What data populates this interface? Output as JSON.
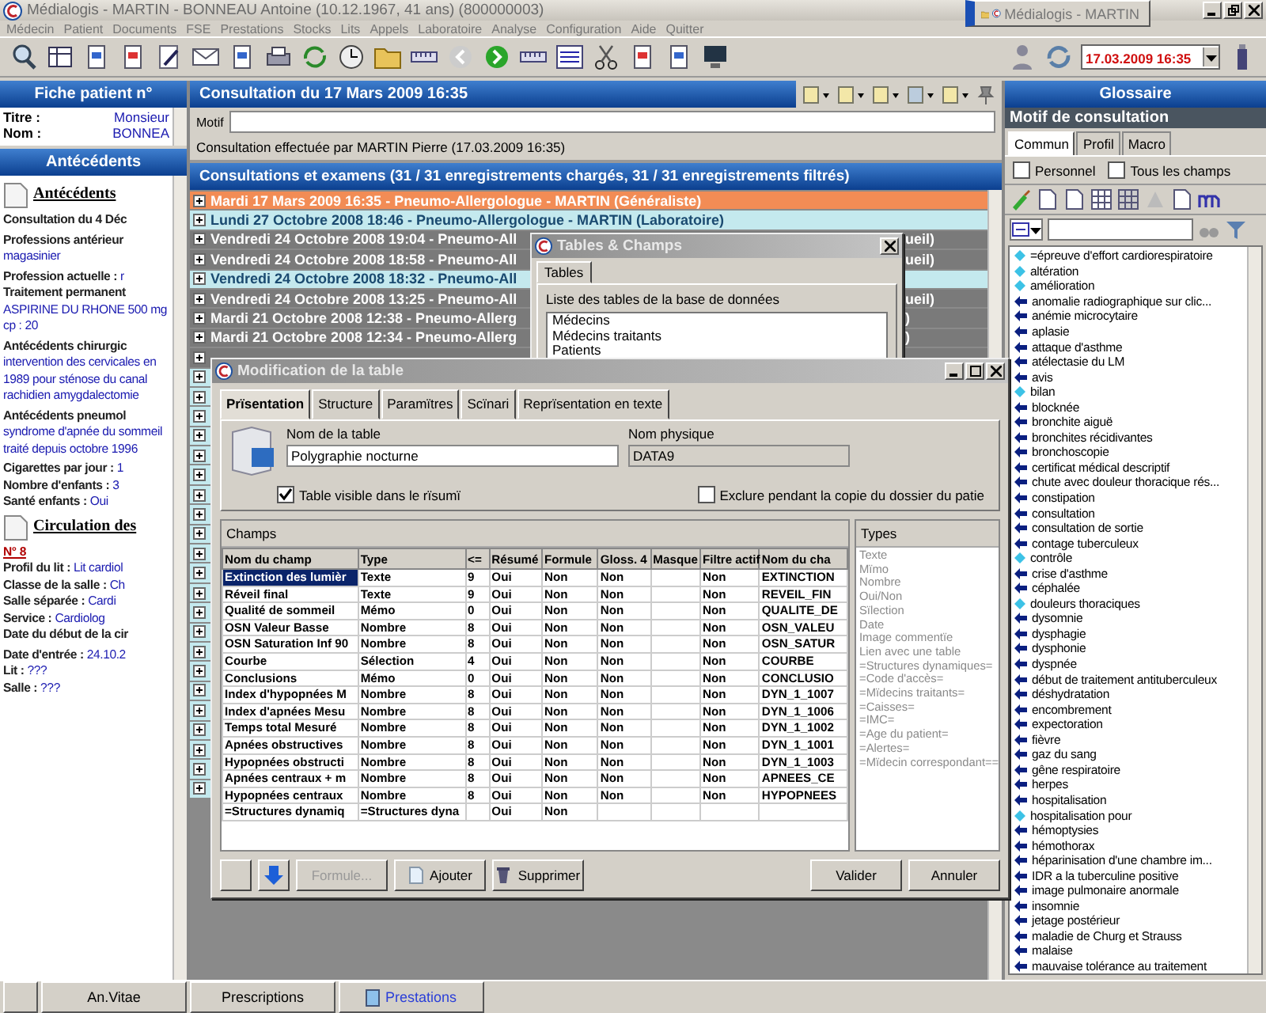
{
  "window": {
    "title": "Médialogis - MARTIN - BONNEAU Antoine   (10.12.1967, 41 ans) (800000003)"
  },
  "task_button": {
    "label": "Médialogis - MARTIN"
  },
  "menu": [
    "Médecin",
    "Patient",
    "Documents",
    "FSE",
    "Prestations",
    "Stocks",
    "Lits",
    "Appels",
    "Laboratoire",
    "Analyse",
    "Configuration",
    "Aide",
    "Quitter"
  ],
  "toolbar": {
    "date": "17.03.2009 16:35"
  },
  "patient_card": {
    "title": "Fiche patient n°",
    "fields": [
      {
        "label": "Titre :",
        "value": "Monsieur"
      },
      {
        "label": "Nom :",
        "value": "BONNEA"
      }
    ]
  },
  "antecedents": {
    "title": "Antécédents",
    "sections": [
      {
        "heading": "Antécédents",
        "entries": [
          {
            "kind": "plain",
            "label": "Consultation du 4 Déc"
          },
          {
            "kind": "block",
            "label": "Professions antérieur",
            "value": "magasinier"
          },
          {
            "kind": "inline",
            "label": "Profession actuelle :",
            "value": "r"
          },
          {
            "kind": "block",
            "label": "Traitement permanent",
            "value": "ASPIRINE DU RHONE 500 mg cp : 20"
          },
          {
            "kind": "block",
            "label": "Antécédents chirurgic",
            "value": "intervention des cervicales en 1989 pour sténose du canal rachidien amygdalectomie"
          },
          {
            "kind": "block",
            "label": "Antécédents pneumol",
            "value": "syndrome d'apnée du sommeil traité depuis octobre 1996"
          },
          {
            "kind": "inline",
            "label": "Cigarettes par jour :",
            "value": "1"
          },
          {
            "kind": "inline",
            "label": "Nombre d'enfants :",
            "value": "3"
          },
          {
            "kind": "inline",
            "label": "Santé enfants :",
            "value": "Oui"
          }
        ]
      },
      {
        "heading": "Circulation des",
        "link": "N° 8",
        "entries": [
          {
            "kind": "inline",
            "label": "Profil du lit :",
            "value": "Lit cardiol"
          },
          {
            "kind": "inline",
            "label": "Classe de la salle :",
            "value": "Ch"
          },
          {
            "kind": "inline",
            "label": "Salle séparée :",
            "value": "Cardi"
          },
          {
            "kind": "inline",
            "label": "Service :",
            "value": "Cardiolog"
          },
          {
            "kind": "plain",
            "label": "Date du début de la cir"
          },
          {
            "kind": "inline",
            "label": "Date d'entrée :",
            "value": "24.10.2"
          },
          {
            "kind": "inline",
            "label": "Lit :",
            "value": "???"
          },
          {
            "kind": "inline",
            "label": "Salle :",
            "value": "???"
          }
        ]
      }
    ]
  },
  "consultation": {
    "title": "Consultation du 17 Mars 2009 16:35",
    "motif_label": "Motif",
    "author": "Consultation effectuée par MARTIN Pierre (17.03.2009 16:35)"
  },
  "records": {
    "title": "Consultations et examens (31 / 31 enregistrements chargés, 31 / 31 enregistrements filtrés)",
    "rows": [
      {
        "kind": "current",
        "text": "Mardi 17 Mars 2009 16:35 - Pneumo-Allergologue - MARTIN (Généraliste)"
      },
      {
        "kind": "light",
        "text": "Lundi 27 Octobre 2008 18:46 - Pneumo-Allergologue - MARTIN (Laboratoire)"
      },
      {
        "kind": "dark",
        "text": "Vendredi 24 Octobre 2008 19:04 - Pneumo-All",
        "tail": "ueil)"
      },
      {
        "kind": "dark",
        "text": "Vendredi 24 Octobre 2008 18:58 - Pneumo-All",
        "tail": "ueil)"
      },
      {
        "kind": "light",
        "text": "Vendredi 24 Octobre 2008 18:32 - Pneumo-All"
      },
      {
        "kind": "dark",
        "text": "Vendredi 24 Octobre 2008 13:25 - Pneumo-All",
        "tail": "ueil)"
      },
      {
        "kind": "dark",
        "text": "Mardi 21 Octobre 2008 12:38 - Pneumo-Allerg",
        "tail": ")"
      },
      {
        "kind": "dark",
        "text": "Mardi 21 Octobre 2008 12:34 - Pneumo-Allerg",
        "tail": ")"
      },
      {
        "kind": "dark"
      },
      {
        "kind": "light"
      },
      {
        "kind": "light"
      },
      {
        "kind": "light"
      },
      {
        "kind": "light"
      },
      {
        "kind": "light"
      },
      {
        "kind": "light"
      },
      {
        "kind": "light"
      },
      {
        "kind": "light"
      },
      {
        "kind": "light"
      },
      {
        "kind": "light"
      },
      {
        "kind": "light"
      },
      {
        "kind": "light"
      },
      {
        "kind": "light"
      },
      {
        "kind": "light"
      },
      {
        "kind": "light"
      },
      {
        "kind": "light"
      },
      {
        "kind": "light"
      },
      {
        "kind": "light"
      },
      {
        "kind": "light"
      },
      {
        "kind": "light"
      },
      {
        "kind": "light"
      },
      {
        "kind": "light"
      }
    ]
  },
  "tables_dialog": {
    "title": "Tables & Champs",
    "tab": "Tables",
    "label": "Liste des tables de la base de données",
    "items": [
      "Médecins",
      "Médecins traitants",
      "Patients"
    ]
  },
  "modif_dialog": {
    "title": "Modification de la table",
    "tabs": [
      {
        "label": "Prïsentation",
        "selected": true
      },
      {
        "label": "Structure",
        "selected": false
      },
      {
        "label": "Paramïtres",
        "selected": false
      },
      {
        "label": "Scïnari",
        "selected": false
      },
      {
        "label": "Reprïsentation en texte",
        "selected": false
      }
    ],
    "name_label": "Nom de la table",
    "name_value": "Polygraphie nocturne",
    "physical_label": "Nom physique",
    "physical_value": "DATA9",
    "checkboxes": [
      {
        "label": "Table visible dans le rïsumï",
        "checked": true
      },
      {
        "label": "Exclure pendant la copie du dossier du patie",
        "checked": false
      }
    ],
    "fields_title": "Champs",
    "columns": [
      "Nom du champ",
      "Type",
      "<=",
      "Résumé",
      "Formule",
      "Gloss. 4",
      "Masque",
      "Filtre actif",
      "Nom du cha"
    ],
    "rows": [
      {
        "selected": true,
        "cells": [
          "Extinction des lumièr",
          "Texte",
          "9",
          "Oui",
          "Non",
          "Non",
          null,
          "Non",
          "EXTINCTION"
        ]
      },
      {
        "selected": false,
        "cells": [
          "Réveil final",
          "Texte",
          "9",
          "Oui",
          "Non",
          "Non",
          null,
          "Non",
          "REVEIL_FIN"
        ]
      },
      {
        "selected": false,
        "cells": [
          "Qualité de sommeil",
          "Mémo",
          "0",
          "Oui",
          "Non",
          "Non",
          null,
          "Non",
          "QUALITE_DE"
        ]
      },
      {
        "selected": false,
        "cells": [
          "OSN Valeur Basse",
          "Nombre",
          "8",
          "Oui",
          "Non",
          "Non",
          null,
          "Non",
          "OSN_VALEU"
        ]
      },
      {
        "selected": false,
        "cells": [
          "OSN Saturation Inf 90",
          "Nombre",
          "8",
          "Oui",
          "Non",
          "Non",
          null,
          "Non",
          "OSN_SATUR"
        ]
      },
      {
        "selected": false,
        "cells": [
          "Courbe",
          "Sélection",
          "4",
          "Oui",
          "Non",
          "Non",
          null,
          "Non",
          "COURBE"
        ]
      },
      {
        "selected": false,
        "cells": [
          "Conclusions",
          "Mémo",
          "0",
          "Oui",
          "Non",
          "Non",
          null,
          "Non",
          "CONCLUSIO"
        ]
      },
      {
        "selected": false,
        "cells": [
          "Index d'hypopnées M",
          "Nombre",
          "8",
          "Oui",
          "Non",
          "Non",
          null,
          "Non",
          "DYN_1_1007"
        ]
      },
      {
        "selected": false,
        "cells": [
          "Index d'apnées Mesu",
          "Nombre",
          "8",
          "Oui",
          "Non",
          "Non",
          null,
          "Non",
          "DYN_1_1006"
        ]
      },
      {
        "selected": false,
        "cells": [
          "Temps total Mesuré",
          "Nombre",
          "8",
          "Oui",
          "Non",
          "Non",
          null,
          "Non",
          "DYN_1_1002"
        ]
      },
      {
        "selected": false,
        "cells": [
          "Apnées obstructives",
          "Nombre",
          "8",
          "Oui",
          "Non",
          "Non",
          null,
          "Non",
          "DYN_1_1001"
        ]
      },
      {
        "selected": false,
        "cells": [
          "Hypopnées obstructi",
          "Nombre",
          "8",
          "Oui",
          "Non",
          "Non",
          null,
          "Non",
          "DYN_1_1003"
        ]
      },
      {
        "selected": false,
        "cells": [
          "Apnées centraux + m",
          "Nombre",
          "8",
          "Oui",
          "Non",
          "Non",
          null,
          "Non",
          "APNEES_CE"
        ]
      },
      {
        "selected": false,
        "cells": [
          "Hypopnées centraux",
          "Nombre",
          "8",
          "Oui",
          "Non",
          "Non",
          null,
          "Non",
          "HYPOPNEES"
        ]
      },
      {
        "selected": false,
        "cells": [
          "=Structures dynamiq",
          "=Structures dyna",
          null,
          "Oui",
          "Non",
          null,
          null,
          null,
          null
        ]
      }
    ],
    "types_title": "Types",
    "types": [
      "Texte",
      "Mïmo",
      "Nombre",
      "Oui/Non",
      "Sïlection",
      "Date",
      "Image commentïe",
      "Lien avec une table",
      "=Structures dynamiques=",
      "=Code d'accès=",
      "=Mïdecins traitants=",
      "=Caisses=",
      "=IMC=",
      "=Age du patient=",
      "=Alertes=",
      "=Mïdecin correspondant=="
    ],
    "buttons": [
      {
        "kind": "blank"
      },
      {
        "kind": "down",
        "disabled": false
      },
      {
        "kind": "text",
        "label": "Formule...",
        "disabled": true
      },
      {
        "kind": "add",
        "label": "Ajouter",
        "disabled": false
      },
      {
        "kind": "delete",
        "label": "Supprimer",
        "disabled": false
      },
      {
        "kind": "text",
        "label": "Valider",
        "disabled": false
      },
      {
        "kind": "text",
        "label": "Annuler",
        "disabled": false
      }
    ]
  },
  "glossary": {
    "title": "Glossaire",
    "subtitle": "Motif de consultation",
    "tabs": [
      {
        "label": "Commun",
        "selected": true
      },
      {
        "label": "Profil",
        "selected": false
      },
      {
        "label": "Macro",
        "selected": false
      }
    ],
    "checkboxes": [
      {
        "label": "Personnel",
        "checked": false
      },
      {
        "label": "Tous les champs",
        "checked": false
      }
    ],
    "items": [
      {
        "kind": "diamond",
        "text": "=épreuve d'effort cardiorespiratoire"
      },
      {
        "kind": "diamond",
        "text": "altération"
      },
      {
        "kind": "diamond",
        "text": "amélioration"
      },
      {
        "kind": "arrow",
        "text": "anomalie radiographique sur clic..."
      },
      {
        "kind": "arrow",
        "text": "anémie microcytaire"
      },
      {
        "kind": "arrow",
        "text": "aplasie"
      },
      {
        "kind": "arrow",
        "text": "attaque d'asthme"
      },
      {
        "kind": "arrow",
        "text": "atélectasie du LM"
      },
      {
        "kind": "arrow",
        "text": "avis"
      },
      {
        "kind": "diamond",
        "text": "bilan"
      },
      {
        "kind": "arrow",
        "text": "blocknée"
      },
      {
        "kind": "arrow",
        "text": "bronchite aiguë"
      },
      {
        "kind": "arrow",
        "text": "bronchites récidivantes"
      },
      {
        "kind": "arrow",
        "text": "bronchoscopie"
      },
      {
        "kind": "arrow",
        "text": "certificat médical descriptif"
      },
      {
        "kind": "arrow",
        "text": "chute avec douleur thoracique rés..."
      },
      {
        "kind": "arrow",
        "text": "constipation"
      },
      {
        "kind": "arrow",
        "text": "consultation"
      },
      {
        "kind": "arrow",
        "text": "consultation de sortie"
      },
      {
        "kind": "arrow",
        "text": "contage tuberculeux"
      },
      {
        "kind": "diamond",
        "text": "contrôle"
      },
      {
        "kind": "arrow",
        "text": "crise d'asthme"
      },
      {
        "kind": "arrow",
        "text": "céphalée"
      },
      {
        "kind": "diamond",
        "text": "douleurs thoraciques"
      },
      {
        "kind": "arrow",
        "text": "dysomnie"
      },
      {
        "kind": "arrow",
        "text": "dysphagie"
      },
      {
        "kind": "arrow",
        "text": "dysphonie"
      },
      {
        "kind": "arrow",
        "text": "dyspnée"
      },
      {
        "kind": "arrow",
        "text": "début de traitement antituberculeux"
      },
      {
        "kind": "arrow",
        "text": "déshydratation"
      },
      {
        "kind": "arrow",
        "text": "encombrement"
      },
      {
        "kind": "arrow",
        "text": "expectoration"
      },
      {
        "kind": "arrow",
        "text": "fièvre"
      },
      {
        "kind": "arrow",
        "text": "gaz du sang"
      },
      {
        "kind": "arrow",
        "text": "gêne respiratoire"
      },
      {
        "kind": "arrow",
        "text": "herpes"
      },
      {
        "kind": "arrow",
        "text": "hospitalisation"
      },
      {
        "kind": "diamond",
        "text": "hospitalisation pour"
      },
      {
        "kind": "arrow",
        "text": "hémoptysies"
      },
      {
        "kind": "arrow",
        "text": "hémothorax"
      },
      {
        "kind": "arrow",
        "text": "héparinisation d'une chambre im..."
      },
      {
        "kind": "arrow",
        "text": "IDR a la tuberculine positive"
      },
      {
        "kind": "arrow",
        "text": "image pulmonaire anormale"
      },
      {
        "kind": "arrow",
        "text": "insomnie"
      },
      {
        "kind": "arrow",
        "text": "jetage postérieur"
      },
      {
        "kind": "arrow",
        "text": "maladie de Churg et Strauss"
      },
      {
        "kind": "arrow",
        "text": "malaise"
      },
      {
        "kind": "arrow",
        "text": "mauvaise tolérance au traitement"
      }
    ]
  },
  "bottom_tabs": [
    {
      "selected": false
    },
    {
      "label": "An.Vitae",
      "selected": false
    },
    {
      "label": "Prescriptions",
      "selected": false
    },
    {
      "label": "Prestations",
      "selected": true
    }
  ]
}
